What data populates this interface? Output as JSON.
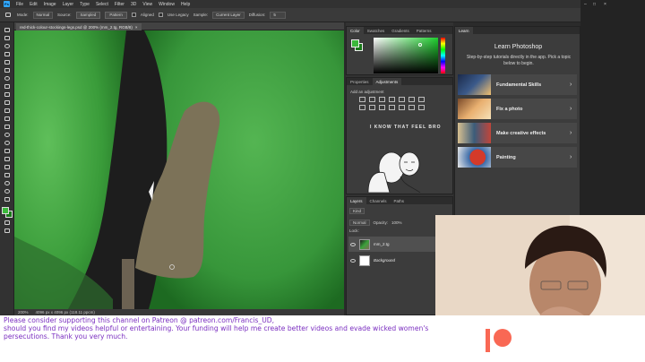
{
  "menu": {
    "logo": "Ps",
    "items": [
      "File",
      "Edit",
      "Image",
      "Layer",
      "Type",
      "Select",
      "Filter",
      "3D",
      "View",
      "Window",
      "Help"
    ]
  },
  "options_bar": {
    "mode_label": "Mode:",
    "mode_value": "Normal",
    "source_label": "Source:",
    "source_sampled": "Sampled",
    "source_pattern": "Pattern",
    "aligned": "Aligned",
    "use_legacy": "Use Legacy",
    "sample_label": "Sample:",
    "sample_value": "Current Layer",
    "diffusion_label": "Diffusion:",
    "diffusion_value": "5"
  },
  "document": {
    "tab_title": "red-thick-colour-stockings-legs.psd @ 200% (mm_2.tg, RGB/8)"
  },
  "status": {
    "zoom": "200%",
    "doc_info": "4096 px x 4096 px (118.11 ppcm)"
  },
  "color_panel": {
    "tabs": [
      "Color",
      "Swatches",
      "Gradients",
      "Patterns"
    ],
    "fg_color": "#3bb83b",
    "bg_color": "#1a7a1a"
  },
  "adjustments_panel": {
    "tabs": [
      "Properties",
      "Adjustments"
    ],
    "add_label": "Add an adjustment",
    "meme_caption": "I KNOW THAT FEEL BRO"
  },
  "layers_panel": {
    "tabs": [
      "Layers",
      "Channels",
      "Paths"
    ],
    "kind_label": "Kind",
    "blend_mode": "Normal",
    "opacity_label": "Opacity:",
    "opacity_value": "100%",
    "lock_label": "Lock:",
    "fill_label": "Fill:",
    "fill_value": "100%",
    "layers": [
      {
        "name": "mm_2.tg",
        "selected": true
      },
      {
        "name": "Background",
        "selected": false
      }
    ]
  },
  "learn_panel": {
    "tab": "Learn",
    "title": "Learn Photoshop",
    "subtitle": "Step-by-step tutorials directly in the app. Pick a topic below to begin.",
    "cards": [
      {
        "label": "Fundamental Skills"
      },
      {
        "label": "Fix a photo"
      },
      {
        "label": "Make creative effects"
      },
      {
        "label": "Painting"
      }
    ]
  },
  "banner": {
    "line1": "Please consider supporting this channel on Patreon @ patreon.com/Francis_UD,",
    "line2": "should you find my videos helpful or entertaining. Your funding will help me create better videos and evade wicked women's",
    "line3": "persecutions.  Thank you very much.",
    "text_color": "#7b2fc0",
    "patreon_color": "#f96854"
  }
}
